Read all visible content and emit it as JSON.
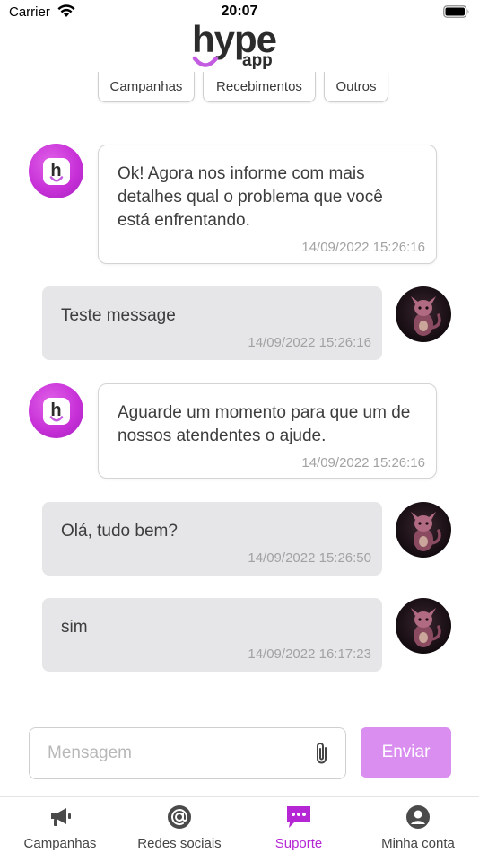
{
  "status_bar": {
    "carrier": "Carrier",
    "time": "20:07"
  },
  "logo": {
    "word": "hype",
    "sub": "app"
  },
  "categories": [
    {
      "label": "Campanhas"
    },
    {
      "label": "Recebimentos"
    },
    {
      "label": "Outros"
    }
  ],
  "messages": [
    {
      "from": "bot",
      "text": "Ok! Agora nos informe com mais detalhes qual o problema que você está enfrentando.",
      "time": "14/09/2022 15:26:16"
    },
    {
      "from": "user",
      "text": "Teste message",
      "time": "14/09/2022 15:26:16"
    },
    {
      "from": "bot",
      "text": "Aguarde um momento para que um de nossos atendentes o ajude.",
      "time": "14/09/2022 15:26:16"
    },
    {
      "from": "user",
      "text": "Olá, tudo bem?",
      "time": "14/09/2022 15:26:50"
    },
    {
      "from": "user",
      "text": "sim",
      "time": "14/09/2022 16:17:23"
    }
  ],
  "composer": {
    "placeholder": "Mensagem",
    "value": "",
    "send_label": "Enviar",
    "attach_icon": "paperclip-icon"
  },
  "tabs": [
    {
      "label": "Campanhas",
      "icon": "megaphone-icon",
      "active": false
    },
    {
      "label": "Redes sociais",
      "icon": "at-sign-icon",
      "active": false
    },
    {
      "label": "Suporte",
      "icon": "chat-icon",
      "active": true
    },
    {
      "label": "Minha conta",
      "icon": "user-icon",
      "active": false
    }
  ],
  "colors": {
    "accent": "#b526d4",
    "send_button": "#d98ef0",
    "user_bubble": "#e6e6e8",
    "bot_avatar": "#c832d8"
  }
}
